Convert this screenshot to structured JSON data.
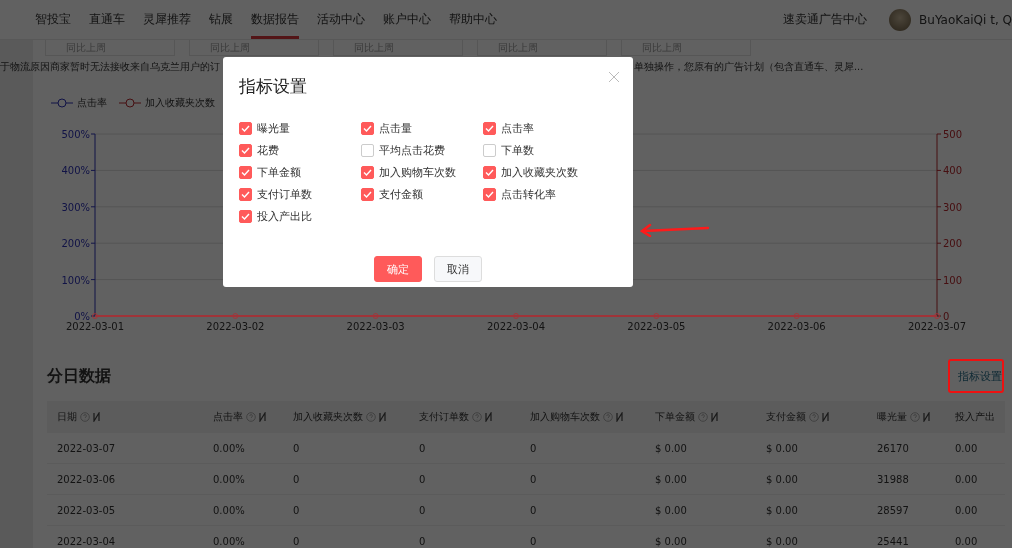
{
  "nav": {
    "items": [
      {
        "label": "智投宝",
        "selected": false
      },
      {
        "label": "直通车",
        "selected": false
      },
      {
        "label": "灵犀推荐",
        "selected": false
      },
      {
        "label": "钻展",
        "selected": false
      },
      {
        "label": "数据报告",
        "selected": true
      },
      {
        "label": "活动中心",
        "selected": false
      },
      {
        "label": "账户中心",
        "selected": false
      },
      {
        "label": "帮助中心",
        "selected": false
      }
    ],
    "right_link": "速卖通广告中心",
    "user": {
      "name": "BuYaoKaiQi t, Q"
    }
  },
  "stat_cards": [
    {
      "label": "同比上周"
    },
    {
      "label": "同比上周"
    },
    {
      "label": "同比上周"
    },
    {
      "label": "同比上周"
    },
    {
      "label": "同比上周"
    }
  ],
  "notice": {
    "text_left": "于物流原因商家暂时无法接收来自乌克兰用户的订",
    "text_right": "单独操作，您原有的广告计划（包含直通车、灵犀..."
  },
  "chart": {
    "chart_data": {
      "type": "line",
      "categories": [
        "2022-03-01",
        "2022-03-02",
        "2022-03-03",
        "2022-03-04",
        "2022-03-05",
        "2022-03-06",
        "2022-03-07"
      ],
      "series": [
        {
          "name": "点击率",
          "color": "#2f34b8",
          "values": [
            null,
            null,
            null,
            null,
            null,
            null,
            null
          ]
        },
        {
          "name": "加入收藏夹次数",
          "color": "#b8282e",
          "marker": "circle",
          "values": [
            0,
            0,
            0,
            0,
            0,
            0,
            0
          ]
        }
      ],
      "grid": true,
      "ylim": [
        0,
        5
      ],
      "y2lim": [
        0,
        500
      ],
      "yticks": [
        {
          "value": 0,
          "label": "0%"
        },
        {
          "value": 1,
          "label": "100%"
        },
        {
          "value": 2,
          "label": "200%"
        },
        {
          "value": 3,
          "label": "300%"
        },
        {
          "value": 4,
          "label": "400%"
        },
        {
          "value": 5,
          "label": "500%"
        }
      ],
      "y2ticks": [
        {
          "value": 0,
          "label": "0"
        },
        {
          "value": 100,
          "label": "100"
        },
        {
          "value": 200,
          "label": "200"
        },
        {
          "value": 300,
          "label": "300"
        },
        {
          "value": 400,
          "label": "400"
        },
        {
          "value": 500,
          "label": "500"
        }
      ]
    }
  },
  "daily": {
    "title": "分日数据",
    "settings_link": "指标设置",
    "columns": [
      "日期",
      "点击率",
      "加入收藏夹次数",
      "支付订单数",
      "加入购物车次数",
      "下单金额",
      "支付金额",
      "曝光量",
      "投入产出"
    ],
    "rows": [
      [
        "2022-03-07",
        "0.00%",
        "0",
        "0",
        "0",
        "$ 0.00",
        "$ 0.00",
        "26170",
        "0.00"
      ],
      [
        "2022-03-06",
        "0.00%",
        "0",
        "0",
        "0",
        "$ 0.00",
        "$ 0.00",
        "31988",
        "0.00"
      ],
      [
        "2022-03-05",
        "0.00%",
        "0",
        "0",
        "0",
        "$ 0.00",
        "$ 0.00",
        "28597",
        "0.00"
      ],
      [
        "2022-03-04",
        "0.00%",
        "0",
        "0",
        "0",
        "$ 0.00",
        "$ 0.00",
        "25441",
        "0.00"
      ]
    ]
  },
  "modal": {
    "title": "指标设置",
    "metrics": [
      {
        "label": "曝光量",
        "checked": true
      },
      {
        "label": "点击量",
        "checked": true
      },
      {
        "label": "点击率",
        "checked": true
      },
      {
        "label": "花费",
        "checked": true
      },
      {
        "label": "平均点击花费",
        "checked": false
      },
      {
        "label": "下单数",
        "checked": false
      },
      {
        "label": "下单金额",
        "checked": true
      },
      {
        "label": "加入购物车次数",
        "checked": true
      },
      {
        "label": "加入收藏夹次数",
        "checked": true
      },
      {
        "label": "支付订单数",
        "checked": true
      },
      {
        "label": "支付金额",
        "checked": true
      },
      {
        "label": "点击转化率",
        "checked": true
      },
      {
        "label": "投入产出比",
        "checked": true
      }
    ],
    "buttons": [
      {
        "label": "确定",
        "kind": "primary"
      },
      {
        "label": "取消",
        "kind": "default"
      }
    ]
  }
}
